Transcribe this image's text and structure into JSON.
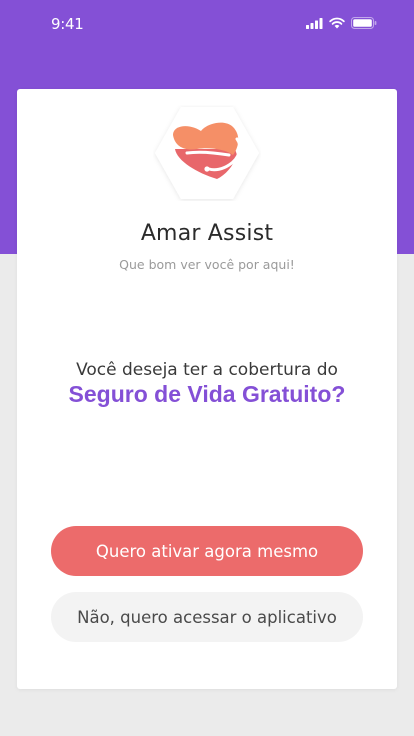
{
  "status_bar": {
    "time": "9:41",
    "icons": [
      "cellular-signal-icon",
      "wifi-icon",
      "battery-icon"
    ]
  },
  "colors": {
    "brand_purple": "#8450d6",
    "primary_button": "#ec6b6b",
    "secondary_button": "#f3f3f3",
    "logo_orange": "#f58f67",
    "logo_pink": "#e8676b"
  },
  "app": {
    "name": "Amar Assist",
    "subtitle": "Que bom ver você por aqui!",
    "logo_icon": "heart-hexagon-logo"
  },
  "question": {
    "line1": "Você deseja ter a cobertura do",
    "line2": "Seguro de Vida Gratuito?"
  },
  "actions": {
    "primary_label": "Quero ativar agora mesmo",
    "secondary_label": "Não, quero acessar o aplicativo"
  }
}
